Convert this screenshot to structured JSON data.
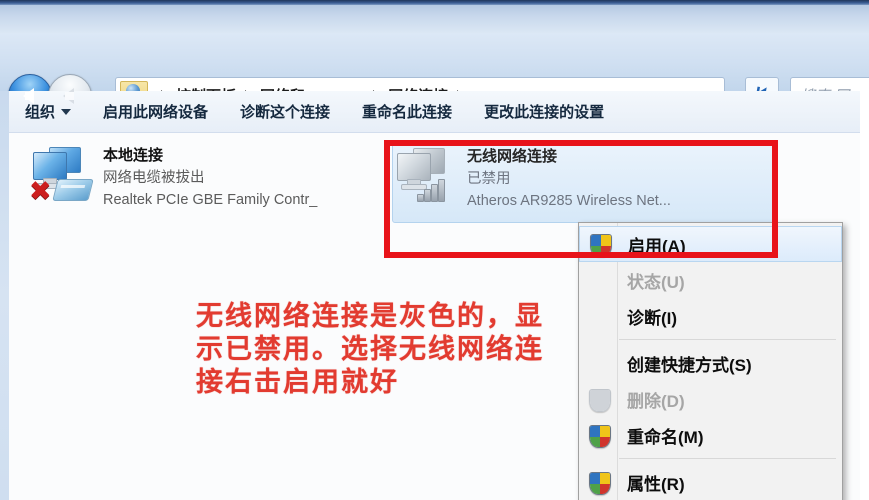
{
  "window": {
    "title": "网络连接"
  },
  "nav": {
    "back_icon": "back-arrow-icon",
    "forward_icon": "forward-arrow-icon",
    "history_dropdown_icon": "chevron-down-icon",
    "refresh_icon": "↯",
    "address_dropdown_icon": "chevron-down-icon",
    "breadcrumbs": [
      "控制面板",
      "网络和 Internet",
      "网络连接"
    ]
  },
  "search": {
    "placeholder": "搜索 网",
    "value": ""
  },
  "toolbar": {
    "items": [
      {
        "label": "组织",
        "has_caret": true
      },
      {
        "label": "启用此网络设备",
        "has_caret": false
      },
      {
        "label": "诊断这个连接",
        "has_caret": false
      },
      {
        "label": "重命名此连接",
        "has_caret": false
      },
      {
        "label": "更改此连接的设置",
        "has_caret": false
      }
    ]
  },
  "connections": [
    {
      "name": "本地连接",
      "status": "网络电缆被拔出",
      "device": "Realtek PCIe GBE Family Contr_",
      "icon": "network-adapter-disconnected-icon",
      "selected": false,
      "disabled": false
    },
    {
      "name": "无线网络连接",
      "status": "已禁用",
      "device": "Atheros AR9285 Wireless Net...",
      "icon": "wireless-adapter-disabled-icon",
      "selected": true,
      "disabled": true
    }
  ],
  "context_menu": {
    "items": [
      {
        "label": "启用(A)",
        "icon": "uac-shield-icon",
        "disabled": false,
        "highlight": true
      },
      {
        "label": "状态(U)",
        "icon": "none",
        "disabled": true,
        "highlight": false
      },
      {
        "label": "诊断(I)",
        "icon": "none",
        "disabled": false,
        "highlight": false
      },
      {
        "separator": true
      },
      {
        "label": "创建快捷方式(S)",
        "icon": "none",
        "disabled": false,
        "highlight": false
      },
      {
        "label": "删除(D)",
        "icon": "uac-shield-gray-icon",
        "disabled": true,
        "highlight": false
      },
      {
        "label": "重命名(M)",
        "icon": "uac-shield-icon",
        "disabled": false,
        "highlight": false
      },
      {
        "separator": true
      },
      {
        "label": "属性(R)",
        "icon": "uac-shield-icon",
        "disabled": false,
        "highlight": false
      }
    ]
  },
  "annotation": {
    "text": "无线网络连接是灰色的，显示已禁用。选择无线网络连接右击启用就好",
    "color": "#e23b30",
    "highlight_box_color": "#e8131a"
  }
}
